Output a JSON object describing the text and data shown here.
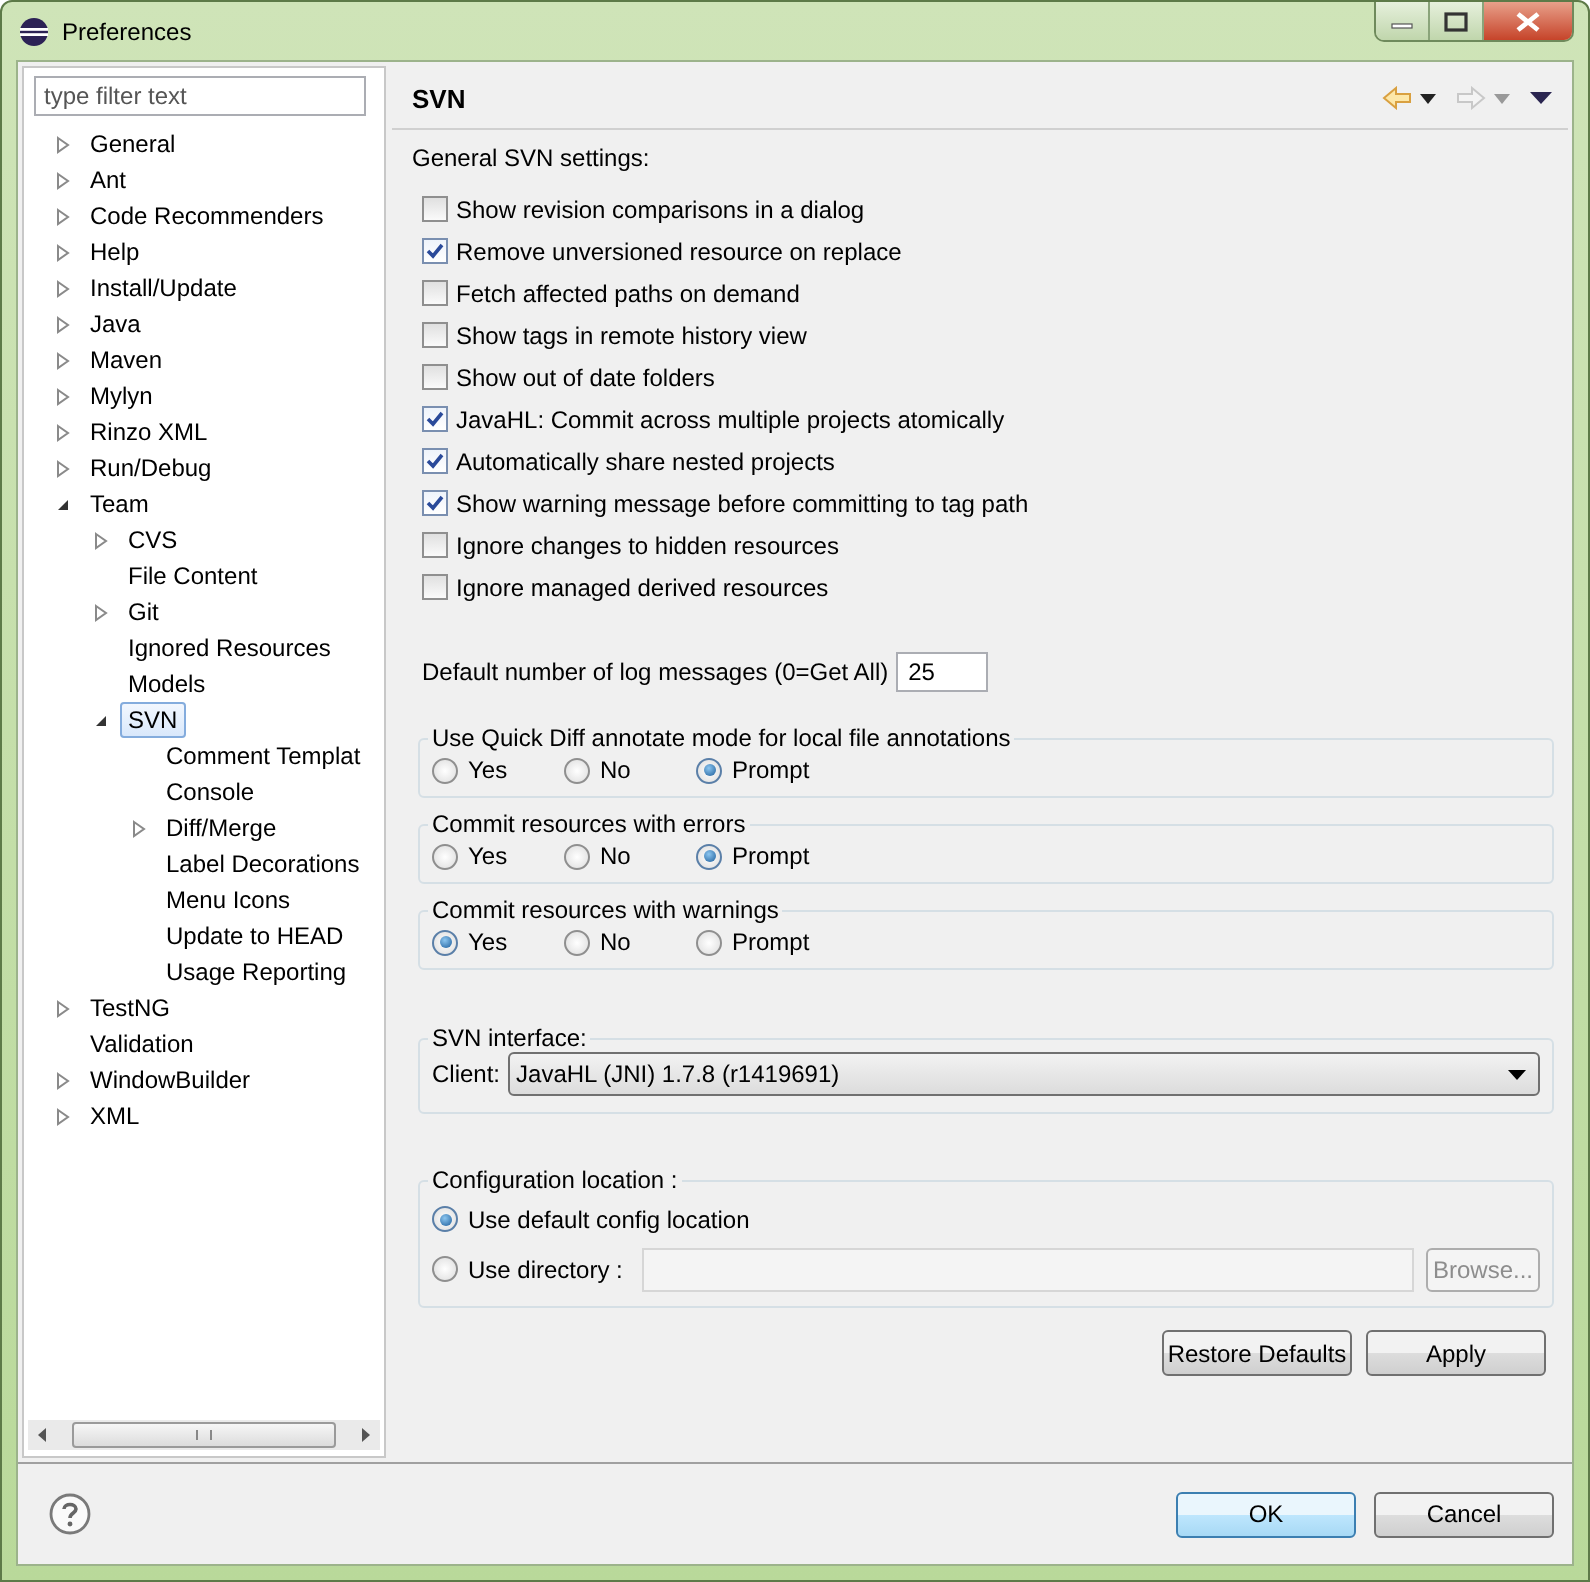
{
  "window": {
    "title": "Preferences"
  },
  "filter": {
    "placeholder": "type filter text"
  },
  "tree": [
    {
      "label": "General",
      "expanded": false
    },
    {
      "label": "Ant",
      "expanded": false
    },
    {
      "label": "Code Recommenders",
      "expanded": false
    },
    {
      "label": "Help",
      "expanded": false
    },
    {
      "label": "Install/Update",
      "expanded": false
    },
    {
      "label": "Java",
      "expanded": false
    },
    {
      "label": "Maven",
      "expanded": false
    },
    {
      "label": "Mylyn",
      "expanded": false
    },
    {
      "label": "Rinzo XML",
      "expanded": false
    },
    {
      "label": "Run/Debug",
      "expanded": false
    },
    {
      "label": "Team",
      "expanded": true,
      "selected": false,
      "children": [
        {
          "label": "CVS",
          "expanded": false
        },
        {
          "label": "File Content"
        },
        {
          "label": "Git",
          "expanded": false
        },
        {
          "label": "Ignored Resources"
        },
        {
          "label": "Models"
        },
        {
          "label": "SVN",
          "expanded": true,
          "selected": true,
          "children": [
            {
              "label": "Comment Templat"
            },
            {
              "label": "Console"
            },
            {
              "label": "Diff/Merge",
              "expanded": false
            },
            {
              "label": "Label Decorations"
            },
            {
              "label": "Menu Icons"
            },
            {
              "label": "Update to HEAD"
            },
            {
              "label": "Usage Reporting"
            }
          ]
        }
      ]
    },
    {
      "label": "TestNG",
      "expanded": false
    },
    {
      "label": "Validation"
    },
    {
      "label": "WindowBuilder",
      "expanded": false
    },
    {
      "label": "XML",
      "expanded": false
    }
  ],
  "page": {
    "title": "SVN",
    "section_label": "General SVN settings:",
    "checkboxes": [
      {
        "label": "Show revision comparisons in a dialog",
        "checked": false
      },
      {
        "label": "Remove unversioned resource on replace",
        "checked": true
      },
      {
        "label": "Fetch affected paths on demand",
        "checked": false
      },
      {
        "label": "Show tags in remote history view",
        "checked": false
      },
      {
        "label": "Show out of date folders",
        "checked": false
      },
      {
        "label": "JavaHL: Commit across multiple projects atomically",
        "checked": true
      },
      {
        "label": "Automatically share nested projects",
        "checked": true
      },
      {
        "label": "Show warning message before committing to tag path",
        "checked": true
      },
      {
        "label": "Ignore changes to hidden resources",
        "checked": false
      },
      {
        "label": "Ignore managed derived resources",
        "checked": false
      }
    ],
    "log_messages": {
      "label": "Default number of log messages (0=Get All)",
      "value": "25"
    },
    "radio_groups": [
      {
        "title": "Use Quick Diff annotate mode for local file annotations",
        "options": [
          {
            "label": "Yes",
            "selected": false
          },
          {
            "label": "No",
            "selected": false
          },
          {
            "label": "Prompt",
            "selected": true
          }
        ]
      },
      {
        "title": "Commit resources with errors",
        "options": [
          {
            "label": "Yes",
            "selected": false
          },
          {
            "label": "No",
            "selected": false
          },
          {
            "label": "Prompt",
            "selected": true
          }
        ]
      },
      {
        "title": "Commit resources with warnings",
        "options": [
          {
            "label": "Yes",
            "selected": true
          },
          {
            "label": "No",
            "selected": false
          },
          {
            "label": "Prompt",
            "selected": false
          }
        ]
      }
    ],
    "interface": {
      "title": "SVN interface:",
      "client_label": "Client:",
      "client_value": "JavaHL (JNI) 1.7.8 (r1419691)"
    },
    "config": {
      "title": "Configuration location :",
      "options": [
        {
          "label": "Use default config location",
          "selected": true,
          "kind": "plain"
        },
        {
          "label": "Use directory :",
          "selected": false,
          "kind": "directory"
        }
      ],
      "browse": {
        "label": "Browse...",
        "disabled": true
      }
    },
    "buttons": [
      "Restore Defaults",
      "Apply"
    ]
  },
  "dialog_buttons": [
    {
      "label": "OK",
      "default": true
    },
    {
      "label": "Cancel",
      "default": false
    }
  ]
}
